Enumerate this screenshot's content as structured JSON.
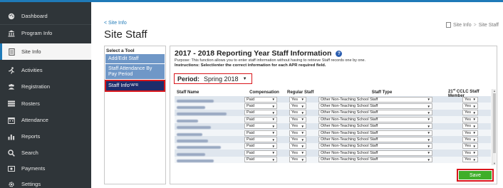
{
  "sidebar": {
    "items": [
      {
        "label": "Dashboard",
        "icon": "palette-icon"
      },
      {
        "label": "Program Info",
        "icon": "institution-icon"
      },
      {
        "label": "Site Info",
        "icon": "document-icon",
        "active": true
      },
      {
        "label": "Activities",
        "icon": "activities-icon"
      },
      {
        "label": "Registration",
        "icon": "users-icon"
      },
      {
        "label": "Rosters",
        "icon": "list-icon"
      },
      {
        "label": "Attendance",
        "icon": "calendar-icon"
      },
      {
        "label": "Reports",
        "icon": "bar-chart-icon"
      },
      {
        "label": "Search",
        "icon": "search-icon"
      },
      {
        "label": "Payments",
        "icon": "payment-icon"
      },
      {
        "label": "Settings",
        "icon": "gear-icon"
      }
    ]
  },
  "header": {
    "back_link": "< Site Info",
    "title": "Site Staff",
    "breadcrumb": [
      "Site Info",
      "Site Staff"
    ]
  },
  "tools": {
    "title": "Select a Tool",
    "items": [
      {
        "label": "Add/Edit Staff"
      },
      {
        "label": "Staff Attendance By Pay Period"
      },
      {
        "label": "Staff Info",
        "suffix": "*APR",
        "active": true
      }
    ]
  },
  "main": {
    "title": "2017 - 2018 Reporting Year Staff Information",
    "purpose": "Purpose: This function allows you to enter staff information without having to retrieve Staff records one by one.",
    "instructions": "Instructions: Select/enter the correct information for each APR required field.",
    "period_label": "Period:",
    "period_value": "Spring 2018",
    "columns": {
      "name": "Staff Name",
      "compensation": "Compensation",
      "regular": "Regular Staff",
      "type": "Staff Type",
      "ccl_prefix": "21",
      "ccl_sup": "st",
      "ccl_rest": " CCLC Staff Member"
    },
    "rows": [
      {
        "compensation": "Paid",
        "regular": "Yes",
        "type": "Other Non-Teaching School Staff",
        "ccl": "Yes"
      },
      {
        "compensation": "Paid",
        "regular": "Yes",
        "type": "Other Non-Teaching School Staff",
        "ccl": "Yes"
      },
      {
        "compensation": "Paid",
        "regular": "Yes",
        "type": "Other Non-Teaching School Staff",
        "ccl": "Yes"
      },
      {
        "compensation": "Paid",
        "regular": "Yes",
        "type": "Other Non-Teaching School Staff",
        "ccl": "Yes"
      },
      {
        "compensation": "Paid",
        "regular": "Yes",
        "type": "Other Non-Teaching School Staff",
        "ccl": "Yes"
      },
      {
        "compensation": "Paid",
        "regular": "Yes",
        "type": "Other Non-Teaching School Staff",
        "ccl": "Yes"
      },
      {
        "compensation": "Paid",
        "regular": "Yes",
        "type": "Other Non-Teaching School Staff",
        "ccl": "Yes"
      },
      {
        "compensation": "Paid",
        "regular": "Yes",
        "type": "Other Non-Teaching School Staff",
        "ccl": "Yes"
      },
      {
        "compensation": "Paid",
        "regular": "Yes",
        "type": "Other Non-Teaching School Staff",
        "ccl": "Yes"
      },
      {
        "compensation": "Paid",
        "regular": "Yes",
        "type": "Other Non-Teaching School Staff",
        "ccl": "Yes"
      }
    ],
    "save_label": "Save"
  },
  "colors": {
    "sidebar_bg": "#2f3539",
    "accent": "#1f7ab8",
    "tool_button": "#6f97c7",
    "tool_active": "#1e2d6b",
    "highlight_red": "#d9161b",
    "save_green": "#3fae2a"
  }
}
